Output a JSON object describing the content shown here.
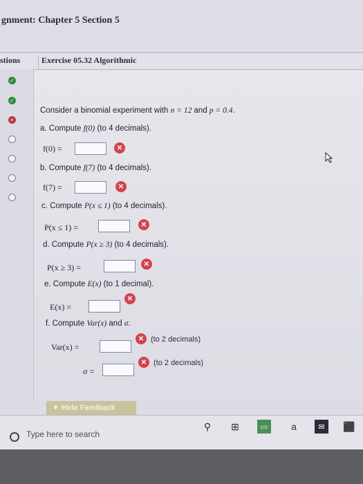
{
  "assignment": {
    "title": "gnment: Chapter 5 Section 5"
  },
  "tabs": {
    "questions": "stions",
    "exercise": "Exercise 05.32 Algorithmic"
  },
  "question_status": [
    {
      "state": "done"
    },
    {
      "state": "done"
    },
    {
      "state": "wrong"
    },
    {
      "state": "empty"
    },
    {
      "state": "empty"
    },
    {
      "state": "empty"
    },
    {
      "state": "empty"
    }
  ],
  "exercise": {
    "intro_prefix": "Consider a binomial experiment with ",
    "intro_n": "n = 12",
    "intro_mid": " and ",
    "intro_p": "p = 0.4",
    "intro_suffix": ".",
    "parts": [
      {
        "prompt_prefix": "a. Compute ",
        "prompt_math": "f(0)",
        "prompt_suffix": " (to 4 decimals).",
        "lhs": "f(0) =",
        "value": ""
      },
      {
        "prompt_prefix": "b. Compute ",
        "prompt_math": "f(7)",
        "prompt_suffix": " (to 4 decimals).",
        "lhs": "f(7) =",
        "value": ""
      },
      {
        "prompt_prefix": "c. Compute ",
        "prompt_math": "P(x ≤ 1)",
        "prompt_suffix": " (to 4 decimals).",
        "lhs": "P(x ≤ 1) =",
        "value": ""
      },
      {
        "prompt_prefix": "d. Compute ",
        "prompt_math": "P(x ≥ 3)",
        "prompt_suffix": " (to 4 decimals).",
        "lhs": "P(x ≥ 3) =",
        "value": ""
      },
      {
        "prompt_prefix": "e. Compute ",
        "prompt_math": "E(x)",
        "prompt_suffix": " (to 1 decimal).",
        "lhs": "E(x) =",
        "value": ""
      }
    ],
    "part_f": {
      "prompt_prefix": "f. Compute ",
      "prompt_math": "Var(x)",
      "prompt_mid": " and ",
      "prompt_sigma": "σ",
      "prompt_suffix": ".",
      "var_lhs": "Var(x) =",
      "var_hint": "(to 2 decimals)",
      "sigma_lhs": "σ =",
      "sigma_hint": "(to 2 decimals)"
    }
  },
  "feedback": {
    "label": "▼ Hide Feedback"
  },
  "taskbar": {
    "search_placeholder": "Type here to search"
  },
  "colors": {
    "error": "#d4434e",
    "correct": "#2f8a3c",
    "wrong": "#b23b45"
  }
}
